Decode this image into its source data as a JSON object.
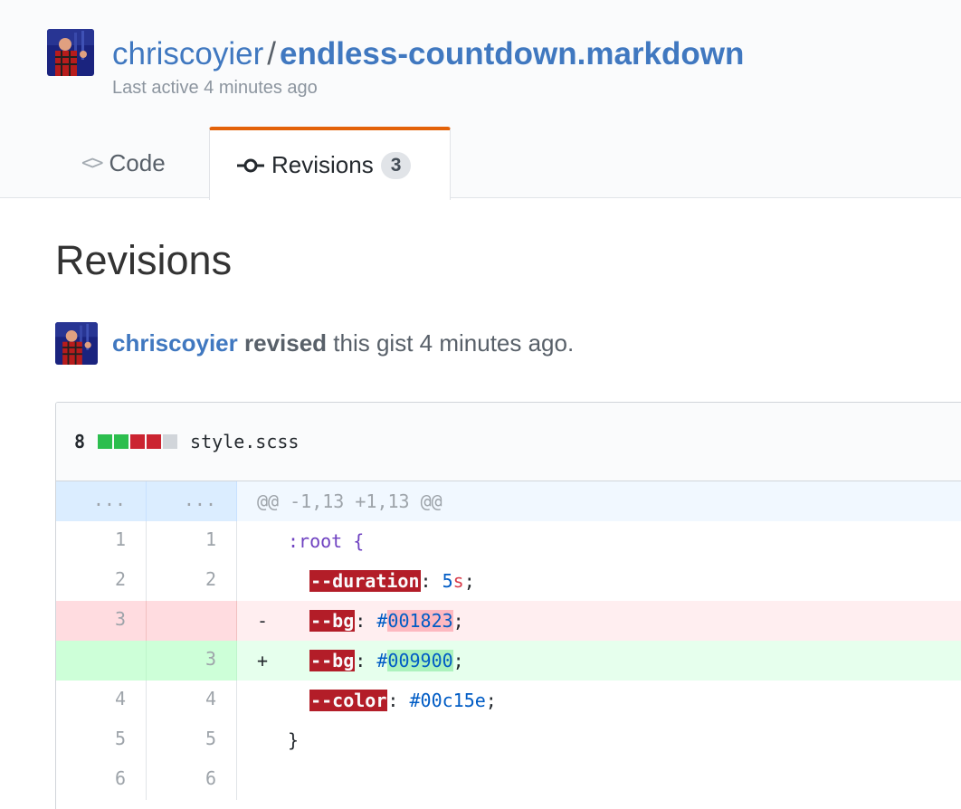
{
  "header": {
    "owner": "chriscoyier",
    "separator": "/",
    "gist_name": "endless-countdown.markdown",
    "last_active": "Last active 4 minutes ago"
  },
  "tabs": {
    "code_label": "Code",
    "revisions_label": "Revisions",
    "revisions_count": "3",
    "code_icon_glyph": "<>"
  },
  "page": {
    "heading": "Revisions"
  },
  "revision": {
    "author": "chriscoyier",
    "action": "revised",
    "rest": " this gist 4 minutes ago."
  },
  "file": {
    "changes": "8",
    "name": "style.scss",
    "diffstat": [
      "add",
      "add",
      "del",
      "del",
      "neutral"
    ],
    "hunk_ellipsis": "...",
    "hunk_header": "@@ -1,13 +1,13 @@",
    "lines": [
      {
        "old": "1",
        "new": "1",
        "marker": " ",
        "text": ":root {"
      },
      {
        "old": "2",
        "new": "2",
        "marker": " ",
        "text": "--duration: 5s;"
      },
      {
        "old": "3",
        "new": "",
        "marker": "-",
        "text": "--bg: #001823;"
      },
      {
        "old": "",
        "new": "3",
        "marker": "+",
        "text": "--bg: #009900;"
      },
      {
        "old": "4",
        "new": "4",
        "marker": " ",
        "text": "--color: #00c15e;"
      },
      {
        "old": "5",
        "new": "5",
        "marker": " ",
        "text": "}"
      },
      {
        "old": "6",
        "new": "6",
        "marker": " ",
        "text": ""
      }
    ]
  },
  "colors": {
    "link": "#4078c0",
    "active_tab_border": "#e36209",
    "diff_add": "#e6ffed",
    "diff_del": "#ffeef0"
  }
}
